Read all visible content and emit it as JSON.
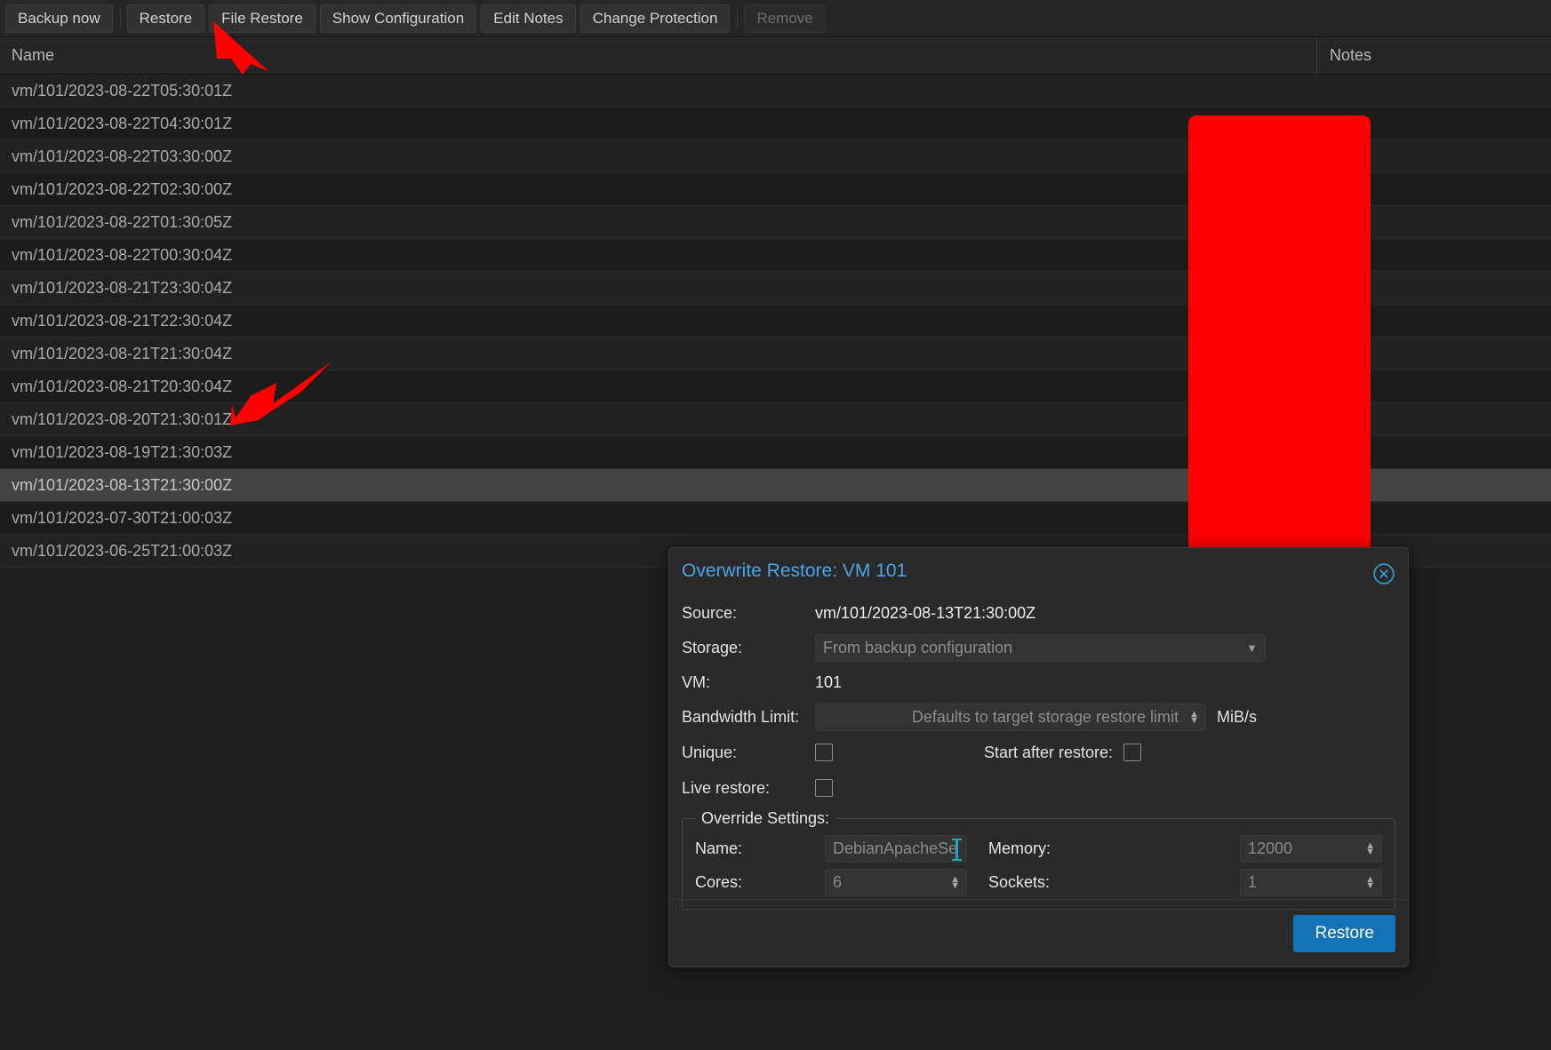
{
  "toolbar": {
    "buttons": [
      {
        "label": "Backup now",
        "disabled": false
      },
      {
        "label": "Restore",
        "disabled": false
      },
      {
        "label": "File Restore",
        "disabled": false
      },
      {
        "label": "Show Configuration",
        "disabled": false
      },
      {
        "label": "Edit Notes",
        "disabled": false
      },
      {
        "label": "Change Protection",
        "disabled": false
      },
      {
        "label": "Remove",
        "disabled": true
      }
    ]
  },
  "grid": {
    "columns": {
      "name": "Name",
      "notes": "Notes"
    },
    "rows": [
      {
        "name": "vm/101/2023-08-22T05:30:01Z",
        "selected": false
      },
      {
        "name": "vm/101/2023-08-22T04:30:01Z",
        "selected": false
      },
      {
        "name": "vm/101/2023-08-22T03:30:00Z",
        "selected": false
      },
      {
        "name": "vm/101/2023-08-22T02:30:00Z",
        "selected": false
      },
      {
        "name": "vm/101/2023-08-22T01:30:05Z",
        "selected": false
      },
      {
        "name": "vm/101/2023-08-22T00:30:04Z",
        "selected": false
      },
      {
        "name": "vm/101/2023-08-21T23:30:04Z",
        "selected": false
      },
      {
        "name": "vm/101/2023-08-21T22:30:04Z",
        "selected": false
      },
      {
        "name": "vm/101/2023-08-21T21:30:04Z",
        "selected": false
      },
      {
        "name": "vm/101/2023-08-21T20:30:04Z",
        "selected": false
      },
      {
        "name": "vm/101/2023-08-20T21:30:01Z",
        "selected": false
      },
      {
        "name": "vm/101/2023-08-19T21:30:03Z",
        "selected": false
      },
      {
        "name": "vm/101/2023-08-13T21:30:00Z",
        "selected": true
      },
      {
        "name": "vm/101/2023-07-30T21:00:03Z",
        "selected": false
      },
      {
        "name": "vm/101/2023-06-25T21:00:03Z",
        "selected": false
      }
    ]
  },
  "annotations": {
    "arrow_color": "#ff0000",
    "redaction_color": "#ff0000"
  },
  "dialog": {
    "title": "Overwrite Restore: VM 101",
    "close_icon": "close-circle-icon",
    "fields": {
      "source_label": "Source:",
      "source_value": "vm/101/2023-08-13T21:30:00Z",
      "storage_label": "Storage:",
      "storage_value": "From backup configuration",
      "vm_label": "VM:",
      "vm_value": "101",
      "bandwidth_label": "Bandwidth Limit:",
      "bandwidth_placeholder": "Defaults to target storage restore limit",
      "bandwidth_unit": "MiB/s",
      "unique_label": "Unique:",
      "start_after_restore_label": "Start after restore:",
      "live_restore_label": "Live restore:"
    },
    "override": {
      "legend": "Override Settings:",
      "name_label": "Name:",
      "name_value": "DebianApacheSe",
      "memory_label": "Memory:",
      "memory_value": "12000",
      "cores_label": "Cores:",
      "cores_value": "6",
      "sockets_label": "Sockets:",
      "sockets_value": "1"
    },
    "footer": {
      "restore_label": "Restore",
      "restore_color": "#1472b8"
    }
  }
}
